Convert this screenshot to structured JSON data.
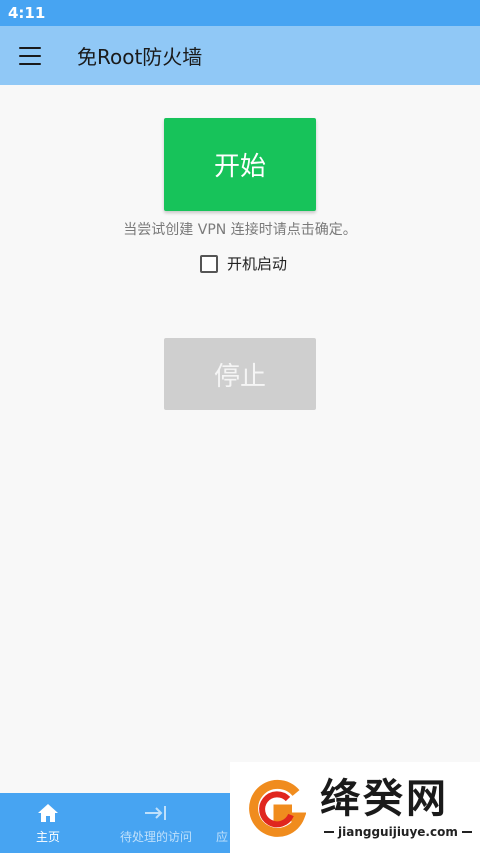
{
  "status_bar": {
    "time": "4:11"
  },
  "app_bar": {
    "title": "免Root防火墙",
    "menu_icon": "hamburger-menu-icon"
  },
  "main": {
    "start_label": "开始",
    "hint": "当尝试创建 VPN 连接时请点击确定。",
    "autostart_label": "开机启动",
    "autostart_checked": false,
    "stop_label": "停止",
    "colors": {
      "start": "#17c35a",
      "stop_disabled": "#cfcfcf"
    }
  },
  "bottom_nav": {
    "items": [
      {
        "label": "主页",
        "icon": "home-icon",
        "active": true
      },
      {
        "label": "待处理的访问",
        "icon": "arrow-to-bar-icon",
        "active": false
      },
      {
        "label": "应",
        "icon": "",
        "active": false
      }
    ],
    "color": "#47a4f2"
  },
  "watermark": {
    "main": "绛癸网",
    "sub": "jiangguijiuye.com"
  }
}
